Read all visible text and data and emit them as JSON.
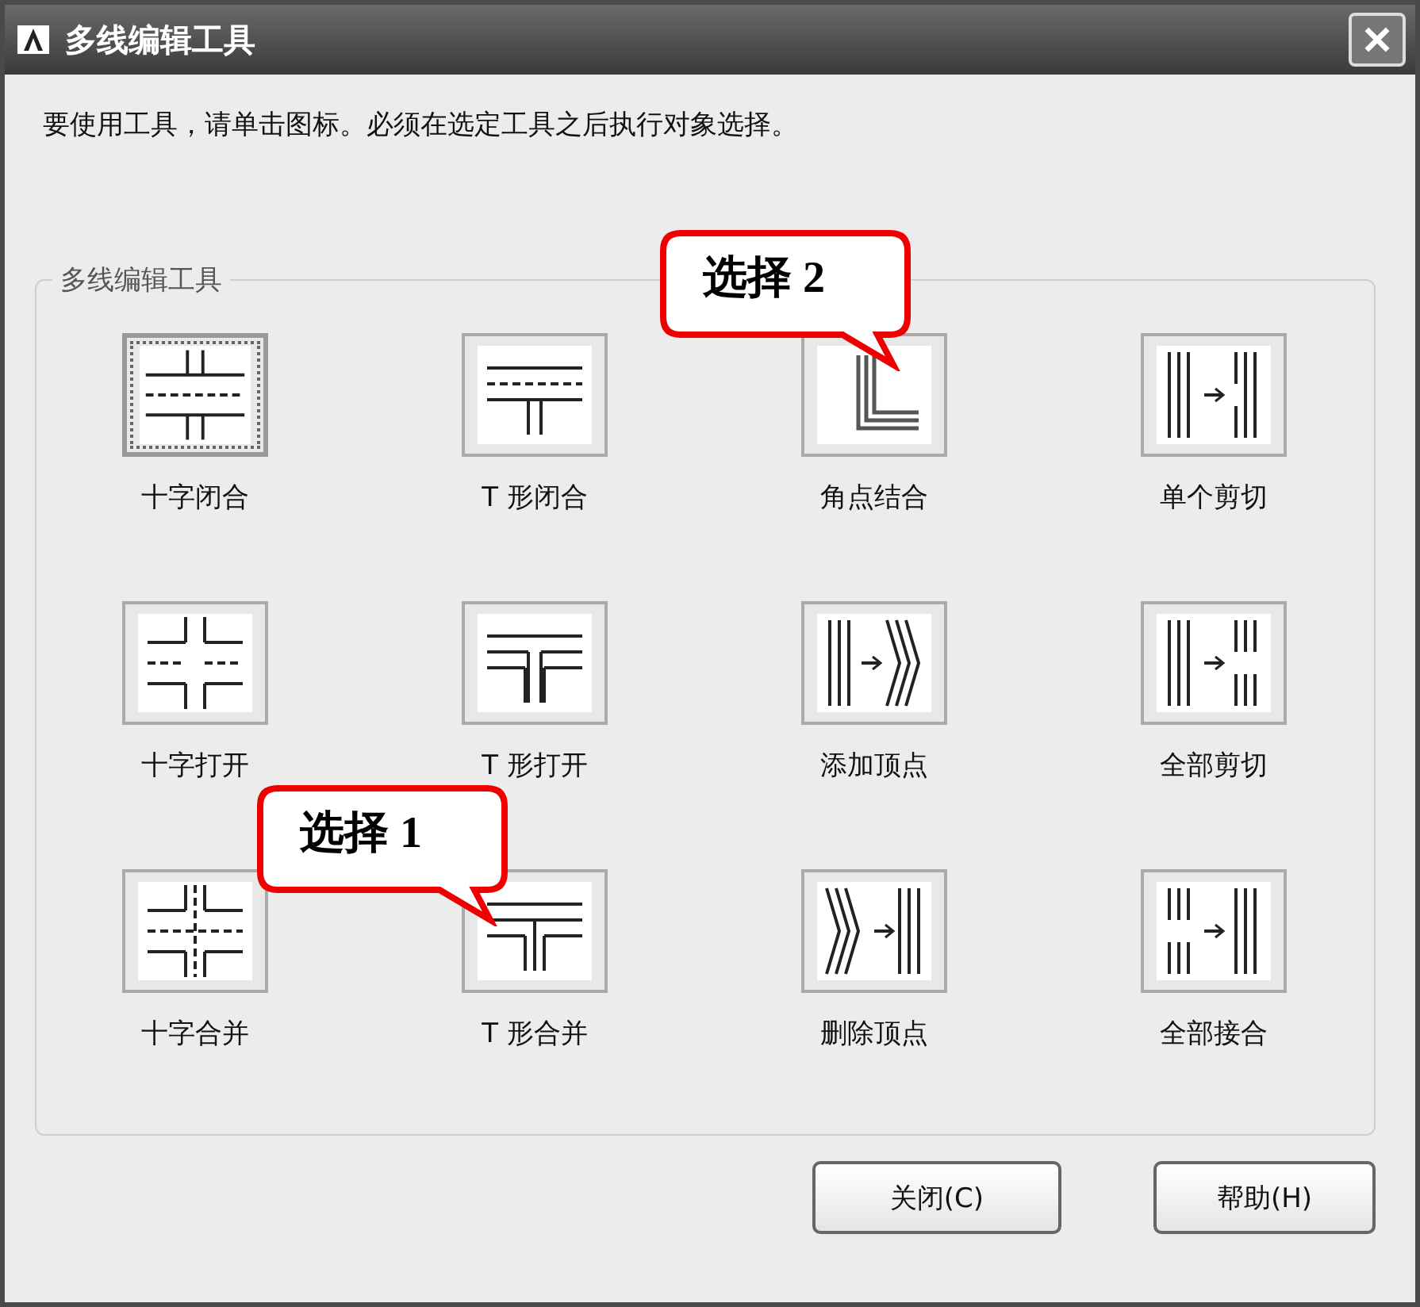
{
  "window": {
    "title": "多线编辑工具"
  },
  "instruction": "要使用工具，请单击图标。必须在选定工具之后执行对象选择。",
  "group": {
    "title": "多线编辑工具",
    "tools": [
      {
        "label": "十字闭合",
        "kind": "cross_closed",
        "selected": true
      },
      {
        "label": "T 形闭合",
        "kind": "tee_closed",
        "selected": false
      },
      {
        "label": "角点结合",
        "kind": "corner_joint",
        "selected": false,
        "callout": "选择 2"
      },
      {
        "label": "单个剪切",
        "kind": "cut_single",
        "selected": false
      },
      {
        "label": "十字打开",
        "kind": "cross_open",
        "selected": false
      },
      {
        "label": "T 形打开",
        "kind": "tee_open",
        "selected": false
      },
      {
        "label": "添加顶点",
        "kind": "add_vertex",
        "selected": false
      },
      {
        "label": "全部剪切",
        "kind": "cut_all",
        "selected": false
      },
      {
        "label": "十字合并",
        "kind": "cross_merge",
        "selected": false
      },
      {
        "label": "T 形合并",
        "kind": "tee_merge",
        "selected": false,
        "callout": "选择 1"
      },
      {
        "label": "删除顶点",
        "kind": "delete_vertex",
        "selected": false
      },
      {
        "label": "全部接合",
        "kind": "weld_all",
        "selected": false
      }
    ]
  },
  "buttons": [
    {
      "label": "关闭(C)"
    },
    {
      "label": "帮助(H)"
    }
  ]
}
